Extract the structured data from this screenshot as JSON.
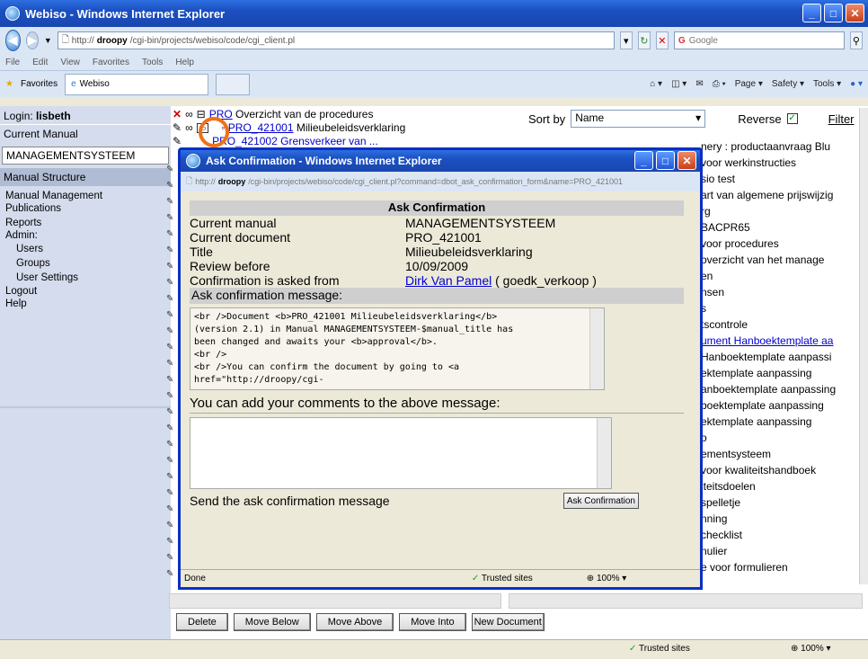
{
  "window": {
    "title": "Webiso - Windows Internet Explorer"
  },
  "address": {
    "url_prefix": "http://",
    "url_host": "droopy",
    "url_path": "/cgi-bin/projects/webiso/code/cgi_client.pl",
    "search_placeholder": "Google"
  },
  "menu": [
    "File",
    "Edit",
    "View",
    "Favorites",
    "Tools",
    "Help"
  ],
  "favbar": {
    "favorites": "Favorites",
    "tab": "Webiso",
    "page": "Page ▾",
    "safety": "Safety ▾",
    "tools": "Tools ▾"
  },
  "sidebar": {
    "login_label": "Login: ",
    "login_user": "lisbeth",
    "current_manual_label": "Current Manual",
    "manual_value": "MANAGEMENTSYSTEEM",
    "structure": "Manual Structure",
    "items": [
      "Manual Management",
      "Publications",
      "Reports",
      "Admin:"
    ],
    "admin_items": [
      "Users",
      "Groups",
      "User Settings"
    ],
    "items2": [
      "Logout",
      "Help"
    ]
  },
  "tree": {
    "row1_code": "PRO",
    "row1_text": " Overzicht van de procedures",
    "row2_code": "PRO_421001",
    "row2_text": " Milieubeleidsverklaring",
    "row3": "PRO_421002 Grensverkeer van ..."
  },
  "right": {
    "sort_label": "Sort by",
    "sort_value": "Name",
    "reverse_label": "Reverse",
    "filter": "Filter",
    "list": [
      "nery : productaanvraag Blu",
      "voor werkinstructies",
      "sio test",
      "art van algemene prijswijzig",
      "rg",
      "BACPR65",
      "voor procedures",
      "overzicht van het manage",
      "en",
      "nsen",
      "",
      "s",
      "tscontrole",
      "ument Hanboektemplate aa",
      "Hanboektemplate aanpassi",
      "ektemplate aanpassing",
      "anboektemplate aanpassing",
      "boektemplate aanpassing",
      "ektemplate aanpassing",
      "o",
      "ementsysteem",
      "voor kwaliteitshandboek",
      "iteitsdoelen",
      "spelletje",
      "nning",
      "checklist",
      "nulier",
      "e voor formulieren"
    ]
  },
  "buttons": [
    "Delete",
    "Move Below",
    "Move Above",
    "Move Into",
    "New Document"
  ],
  "status": {
    "zone": "Trusted sites",
    "zoom": "100%"
  },
  "dialog": {
    "title": "Ask Confirmation - Windows Internet Explorer",
    "url_prefix": "http://",
    "url_host": "droopy",
    "url_path": "/cgi-bin/projects/webiso/code/cgi_client.pl?command=dbot_ask_confirmation_form&name=PRO_421001",
    "header": "Ask Confirmation",
    "fields": [
      {
        "k": "Current manual",
        "v": "MANAGEMENTSYSTEEM"
      },
      {
        "k": "Current document",
        "v": "PRO_421001"
      },
      {
        "k": "Title",
        "v": "Milieubeleidsverklaring"
      },
      {
        "k": "Review before",
        "v": "10/09/2009"
      }
    ],
    "asked_from_label": "Confirmation is asked from",
    "asked_from_name": "Dirk Van Pamel",
    "asked_from_user": " ( goedk_verkoop )",
    "msg_label": "Ask confirmation message:",
    "message": "<br />Document <b>PRO_421001 Milieubeleidsverklaring</b>\n(version 2.1) in Manual MANAGEMENTSYSTEEM-$manual_title has\nbeen changed and awaits your <b>approval</b>.\n<br />\n<br />You can confirm the document by going to <a\nhref=\"http://droopy/cgi-",
    "comments_label": "You can add your comments to the above message:",
    "send_label": "Send the ask confirmation message",
    "send_button": "Ask Confirmation",
    "status_done": "Done",
    "status_zone": "Trusted sites",
    "status_zoom": "100%"
  }
}
